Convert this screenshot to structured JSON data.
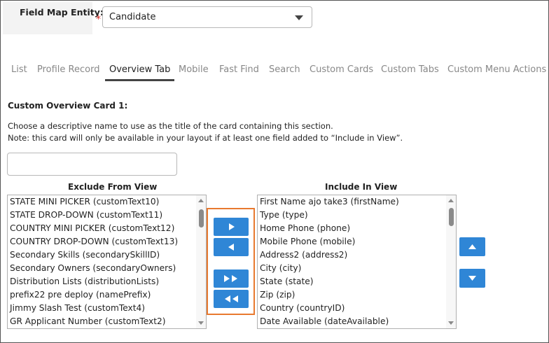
{
  "entity": {
    "label": "Field Map Entity:",
    "required_mark": "*",
    "selected": "Candidate"
  },
  "tabs": [
    {
      "label": "List",
      "active": false
    },
    {
      "label": "Profile Record",
      "active": false
    },
    {
      "label": "Overview Tab",
      "active": true
    },
    {
      "label": "Mobile",
      "active": false
    },
    {
      "label": "Fast Find",
      "active": false
    },
    {
      "label": "Search",
      "active": false
    },
    {
      "label": "Custom Cards",
      "active": false
    },
    {
      "label": "Custom Tabs",
      "active": false
    },
    {
      "label": "Custom Menu Actions",
      "active": false
    }
  ],
  "section": {
    "title": "Custom Overview Card 1:",
    "desc1": "Choose a descriptive name to use as the title of the card containing this section.",
    "desc2": "Note: this card will only be available in your layout if at least one field added to “Include in View”.",
    "name_value": ""
  },
  "exclude": {
    "title": "Exclude From View",
    "items": [
      "STATE MINI PICKER (customText10)",
      "STATE DROP-DOWN (customText11)",
      "COUNTRY MINI PICKER (customText12)",
      "COUNTRY DROP-DOWN (customText13)",
      "Secondary Skills (secondarySkillID)",
      "Secondary Owners (secondaryOwners)",
      "Distribution Lists (distributionLists)",
      "prefix22 pre deploy (namePrefix)",
      "Jimmy Slash Test (customText4)",
      "GR Applicant Number (customText2)"
    ]
  },
  "include": {
    "title": "Include In View",
    "items": [
      "First Name ajo take3 (firstName)",
      "Type (type)",
      "Home Phone (phone)",
      "Mobile Phone (mobile)",
      "Address2 (address2)",
      "City (city)",
      "State (state)",
      "Zip (zip)",
      "Country (countryID)",
      "Date Available (dateAvailable)"
    ]
  },
  "controls": {
    "move_right": "right-arrow-icon",
    "move_left": "left-arrow-icon",
    "move_all_right": "double-right-arrow-icon",
    "move_all_left": "double-left-arrow-icon",
    "move_up": "up-arrow-icon",
    "move_down": "down-arrow-icon",
    "button_color": "#2f86d6",
    "highlight_color": "#e8792f"
  }
}
